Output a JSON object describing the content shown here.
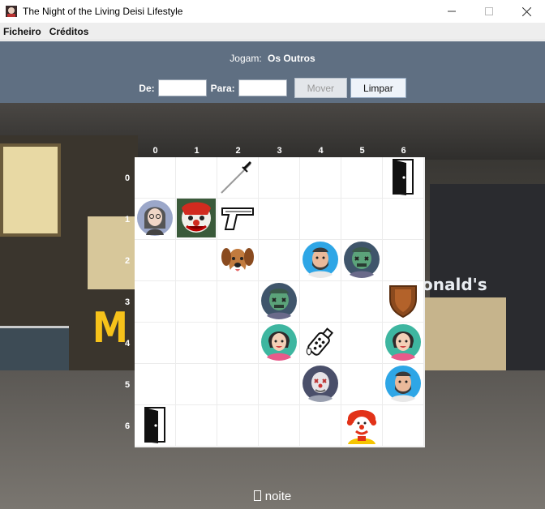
{
  "window": {
    "title": "The Night of the Living Deisi Lifestyle"
  },
  "menu": {
    "items": [
      "Ficheiro",
      "Créditos"
    ]
  },
  "panel": {
    "players_label": "Jogam:",
    "players_value": "Os Outros",
    "from_label": "De:",
    "to_label": "Para:",
    "from_value": "",
    "to_value": "",
    "move_button": "Mover",
    "clear_button": "Limpar"
  },
  "board": {
    "columns": [
      "0",
      "1",
      "2",
      "3",
      "4",
      "5",
      "6"
    ],
    "rows": [
      "0",
      "1",
      "2",
      "3",
      "4",
      "5",
      "6"
    ],
    "cells": [
      {
        "row": 0,
        "col": 2,
        "item": "katana-icon"
      },
      {
        "row": 0,
        "col": 6,
        "item": "door-icon"
      },
      {
        "row": 1,
        "col": 0,
        "item": "human-avatar-icon"
      },
      {
        "row": 1,
        "col": 1,
        "item": "zombie-clown-icon"
      },
      {
        "row": 1,
        "col": 2,
        "item": "pistol-icon"
      },
      {
        "row": 2,
        "col": 2,
        "item": "dog-icon"
      },
      {
        "row": 2,
        "col": 4,
        "item": "bearded-man-avatar-icon"
      },
      {
        "row": 2,
        "col": 5,
        "item": "zombie-avatar-icon"
      },
      {
        "row": 3,
        "col": 3,
        "item": "zombie-avatar-icon"
      },
      {
        "row": 3,
        "col": 6,
        "item": "shield-icon"
      },
      {
        "row": 4,
        "col": 3,
        "item": "woman-avatar-icon"
      },
      {
        "row": 4,
        "col": 4,
        "item": "spray-bottle-icon"
      },
      {
        "row": 4,
        "col": 6,
        "item": "woman-avatar-icon"
      },
      {
        "row": 5,
        "col": 4,
        "item": "zombie-clown-avatar-icon"
      },
      {
        "row": 5,
        "col": 6,
        "item": "bearded-man-avatar-icon"
      },
      {
        "row": 6,
        "col": 0,
        "item": "door-icon"
      },
      {
        "row": 6,
        "col": 5,
        "item": "ronald-clown-icon"
      }
    ]
  },
  "status": {
    "time_of_day": "noite"
  },
  "colors": {
    "panel": "#5f6f82",
    "board": "#ffffff"
  }
}
